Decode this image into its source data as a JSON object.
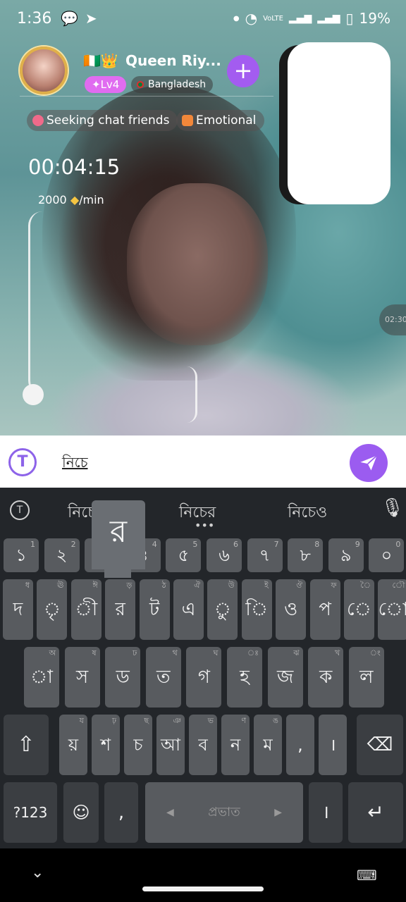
{
  "status_bar": {
    "time": "1:36",
    "left_icons": [
      "chat-bubble",
      "telegram"
    ],
    "right_icons": [
      "dot",
      "wifi",
      "volte-lte",
      "signal-1",
      "signal-2",
      "battery"
    ],
    "volte_label": "VoLTE",
    "battery": "19%"
  },
  "caller": {
    "flag_and_crown": "🇨🇮👑",
    "name": "Queen Riy...",
    "level": "Lv4",
    "country": "Bangladesh",
    "add_label": "+"
  },
  "tags": [
    "Seeking chat friends",
    "Emotional"
  ],
  "call": {
    "timer": "00:04:15",
    "rate_amount": "2000",
    "rate_unit": "/min",
    "side_chip": "02:30"
  },
  "input": {
    "logo_letter": "T",
    "text": "নিচে"
  },
  "keyboard": {
    "suggestions": [
      "নিচে",
      "নিচের",
      "নিচেও"
    ],
    "popup_char": "র",
    "number_row": [
      {
        "l": "১",
        "h": "1"
      },
      {
        "l": "২",
        "h": "2"
      },
      {
        "l": "৩",
        "h": "3"
      },
      {
        "l": "৪",
        "h": "4"
      },
      {
        "l": "৫",
        "h": "5"
      },
      {
        "l": "৬",
        "h": "6"
      },
      {
        "l": "৭",
        "h": "7"
      },
      {
        "l": "৮",
        "h": "8"
      },
      {
        "l": "৯",
        "h": "9"
      },
      {
        "l": "০",
        "h": "0"
      }
    ],
    "row1": [
      {
        "l": "দ",
        "h": "ধ"
      },
      {
        "l": "ৃ",
        "h": "ঊ"
      },
      {
        "l": "ী",
        "h": "ঈ"
      },
      {
        "l": "র",
        "h": "ড়"
      },
      {
        "l": "ট",
        "h": "ঠ"
      },
      {
        "l": "এ",
        "h": "ঐ"
      },
      {
        "l": "ু",
        "h": "উ"
      },
      {
        "l": "ি",
        "h": "ই"
      },
      {
        "l": "ও",
        "h": "ঔ"
      },
      {
        "l": "প",
        "h": "ফ"
      },
      {
        "l": "ে",
        "h": "ৈ"
      },
      {
        "l": "ো",
        "h": "ৌ"
      }
    ],
    "row2": [
      {
        "l": "া",
        "h": "অ"
      },
      {
        "l": "স",
        "h": "ষ"
      },
      {
        "l": "ড",
        "h": "ঢ"
      },
      {
        "l": "ত",
        "h": "থ"
      },
      {
        "l": "গ",
        "h": "ঘ"
      },
      {
        "l": "হ",
        "h": "ঃ"
      },
      {
        "l": "জ",
        "h": "ঝ"
      },
      {
        "l": "ক",
        "h": "খ"
      },
      {
        "l": "ল",
        "h": "ং"
      }
    ],
    "row3": [
      {
        "l": "য়",
        "h": "য"
      },
      {
        "l": "শ",
        "h": "ঢ়"
      },
      {
        "l": "চ",
        "h": "ছ"
      },
      {
        "l": "আ",
        "h": "ঞ"
      },
      {
        "l": "ব",
        "h": "ভ"
      },
      {
        "l": "ন",
        "h": "ণ"
      },
      {
        "l": "ম",
        "h": "ঙ"
      },
      {
        "l": ",",
        "h": ""
      },
      {
        "l": "।",
        "h": ""
      }
    ],
    "symbols_label": "?123",
    "comma": ",",
    "space_label": "প্রভাত",
    "period": "।"
  }
}
